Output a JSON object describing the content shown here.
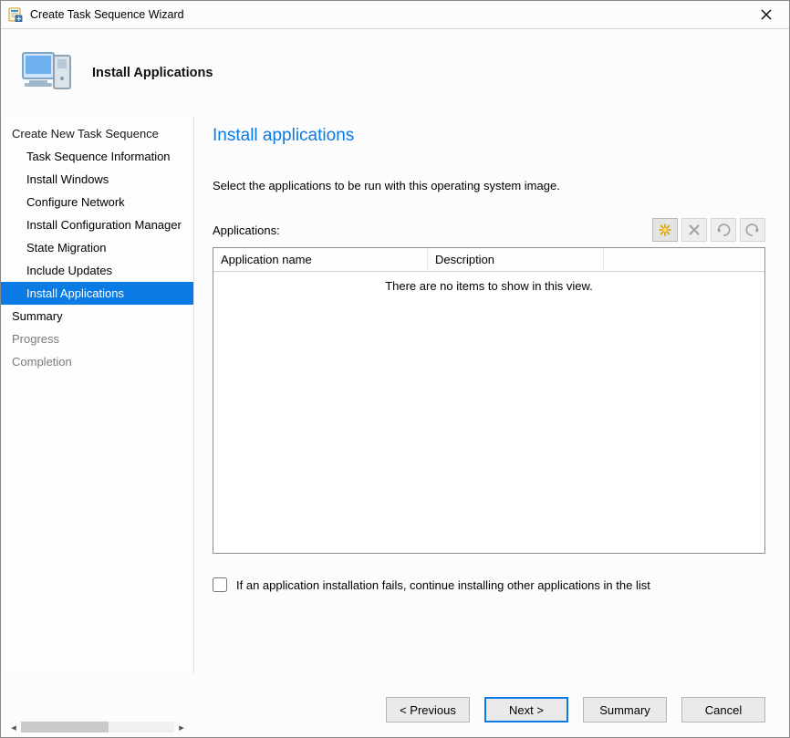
{
  "window": {
    "title": "Create Task Sequence Wizard"
  },
  "banner": {
    "title": "Install Applications"
  },
  "sidebar": {
    "group_title": "Create New Task Sequence",
    "steps": [
      {
        "label": "Task Sequence Information",
        "selected": false
      },
      {
        "label": "Install Windows",
        "selected": false
      },
      {
        "label": "Configure Network",
        "selected": false
      },
      {
        "label": "Install Configuration Manager",
        "selected": false
      },
      {
        "label": "State Migration",
        "selected": false
      },
      {
        "label": "Include Updates",
        "selected": false
      },
      {
        "label": "Install Applications",
        "selected": true
      }
    ],
    "post_steps": [
      {
        "label": "Summary",
        "muted": false
      },
      {
        "label": "Progress",
        "muted": true
      },
      {
        "label": "Completion",
        "muted": true
      }
    ]
  },
  "main": {
    "title": "Install applications",
    "instruction": "Select the applications to be run with this operating system image.",
    "applications_label": "Applications:",
    "columns": {
      "name": "Application name",
      "description": "Description"
    },
    "empty": "There are no items to show in this view.",
    "toolbar": {
      "new": "New",
      "delete": "Delete",
      "move_up": "Move up",
      "move_down": "Move down"
    },
    "checkbox_label": "If an application installation fails, continue installing other applications in the list"
  },
  "footer": {
    "previous": "< Previous",
    "next": "Next >",
    "summary": "Summary",
    "cancel": "Cancel"
  }
}
